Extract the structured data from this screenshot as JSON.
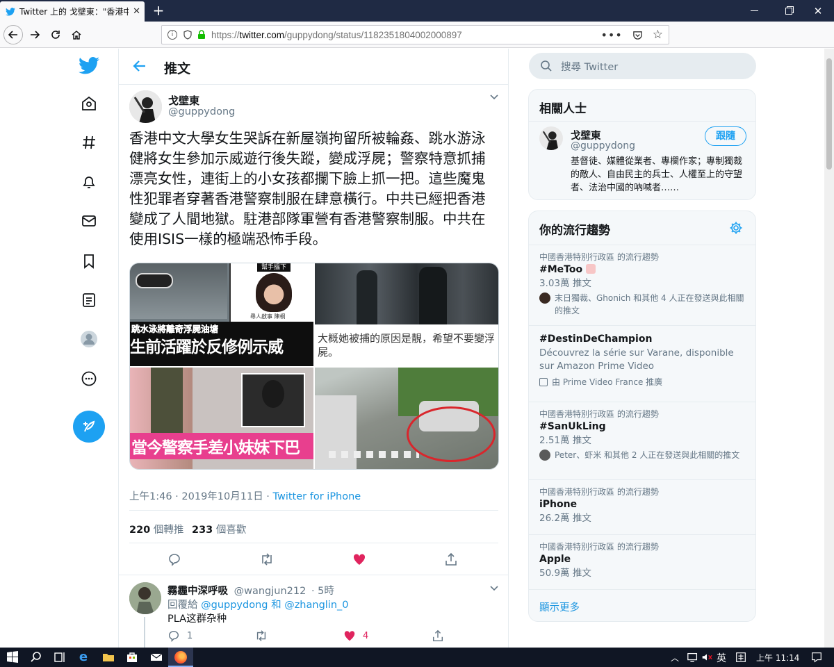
{
  "browser": {
    "tab_title": "Twitter 上的 戈壁東：\"香港中文",
    "url_prefix": "https://",
    "url_host": "twitter.com",
    "url_path": "/guppydong/status/1182351804002000897"
  },
  "page": {
    "title": "推文"
  },
  "tweet": {
    "author_name": "戈壁東",
    "author_handle": "@guppydong",
    "text": "香港中文大學女生哭訴在新屋嶺拘留所被輪姦、跳水游泳健將女生參加示威遊行後失蹤，變成浮屍；警察特意抓捕漂亮女性，連街上的小女孩都攔下臉上抓一把。這些魔鬼性犯罪者穿著香港警察制服在肆意橫行。中共已經把香港變成了人間地獄。駐港部隊軍營有香港警察制服。中共在使用ISIS一樣的極端恐怖手段。",
    "media_captions": {
      "img1_tag": "幫手搵下",
      "img1_line1": "跳水泳將離奇浮屍油塘",
      "img1_line2": "生前活躍於反修例示威",
      "img1_small": "尋人啟事 陳桐",
      "img2_text": "大概她被捕的原因是靚，希望不要變浮屍。",
      "img3_text": "當今警察手差小妹妹下巴"
    },
    "timestamp": "上午1:46 · 2019年10月11日 · ",
    "source": "Twitter for iPhone",
    "retweets_count": "220",
    "retweets_label": "個轉推",
    "likes_count": "233",
    "likes_label": "個喜歡"
  },
  "reply": {
    "author_name": "霧霾中深呼吸",
    "author_handle": "@wangjun212",
    "time": "· 5時",
    "reply_to_prefix": "回覆給",
    "reply_to_1": "@guppydong",
    "reply_to_and": "和",
    "reply_to_2": "@zhanglin_0",
    "text": "PLA这群杂种",
    "reply_count": "1",
    "like_count": "4"
  },
  "sidebar": {
    "search_placeholder": "搜尋 Twitter",
    "related_title": "相關人士",
    "related_user": {
      "name": "戈壁東",
      "handle": "@guppydong",
      "follow_label": "跟隨",
      "bio": "基督徒、媒體從業者、專欄作家；專制獨裁的敵人、自由民主的兵士、人權至上的守望者、法治中國的吶喊者……"
    },
    "trends_title": "你的流行趨勢",
    "trends": [
      {
        "context": "中國香港特別行政區 的流行趨勢",
        "name": "#MeToo",
        "count": "3.03萬 推文",
        "people": "末日獨裁、Ghonich 和其他 4 人正在發送與此相關的推文"
      },
      {
        "context": "",
        "name": "#DestinDeChampion",
        "desc": "Découvrez la série sur Varane, disponible sur Amazon Prime Video",
        "promoted": "由 Prime Video France 推廣"
      },
      {
        "context": "中國香港特別行政區 的流行趨勢",
        "name": "#SanUkLing",
        "count": "2.51萬 推文",
        "people": "Peter、虾米 和其他 2 人正在發送與此相關的推文"
      },
      {
        "context": "中國香港特別行政區 的流行趨勢",
        "name": "iPhone",
        "count": "26.2萬 推文"
      },
      {
        "context": "中國香港特別行政區 的流行趨勢",
        "name": "Apple",
        "count": "50.9萬 推文"
      }
    ],
    "show_more": "顯示更多"
  },
  "taskbar": {
    "ime": "英",
    "time": "上午 11:14"
  },
  "colors": {
    "twitter_blue": "#1da1f2",
    "like_red": "#e0245e",
    "title_bar": "#1f2a44",
    "taskbar": "#101624"
  }
}
